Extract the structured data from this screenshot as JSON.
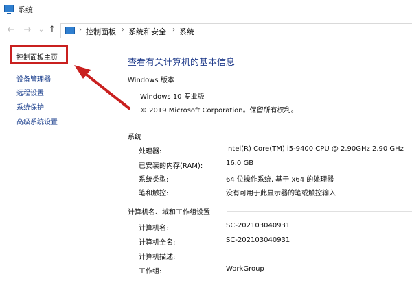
{
  "window": {
    "title": "系统"
  },
  "nav": {
    "back": "←",
    "forward": "→",
    "dropdown": "⌄",
    "up": "↑",
    "breadcrumbs": [
      "控制面板",
      "系统和安全",
      "系统"
    ],
    "separator": "›"
  },
  "sidebar": {
    "items": [
      {
        "label": "控制面板主页"
      },
      {
        "label": "设备管理器"
      },
      {
        "label": "远程设置"
      },
      {
        "label": "系统保护"
      },
      {
        "label": "高级系统设置"
      }
    ]
  },
  "main": {
    "title": "查看有关计算机的基本信息",
    "windows_section": {
      "heading": "Windows 版本",
      "edition": "Windows 10 专业版",
      "copyright": "© 2019 Microsoft Corporation。保留所有权利。"
    },
    "system_section": {
      "heading": "系统",
      "rows": [
        {
          "label": "处理器:",
          "value": "Intel(R) Core(TM) i5-9400 CPU @ 2.90GHz   2.90 GHz"
        },
        {
          "label": "已安装的内存(RAM):",
          "value": "16.0 GB"
        },
        {
          "label": "系统类型:",
          "value": "64 位操作系统, 基于 x64 的处理器"
        },
        {
          "label": "笔和触控:",
          "value": "没有可用于此显示器的笔或触控输入"
        }
      ]
    },
    "computer_section": {
      "heading": "计算机名、域和工作组设置",
      "rows": [
        {
          "label": "计算机名:",
          "value": "SC-202103040931"
        },
        {
          "label": "计算机全名:",
          "value": "SC-202103040931"
        },
        {
          "label": "计算机描述:",
          "value": ""
        },
        {
          "label": "工作组:",
          "value": "WorkGroup"
        }
      ]
    }
  },
  "annotation": {
    "highlight_color": "#c9201f"
  }
}
